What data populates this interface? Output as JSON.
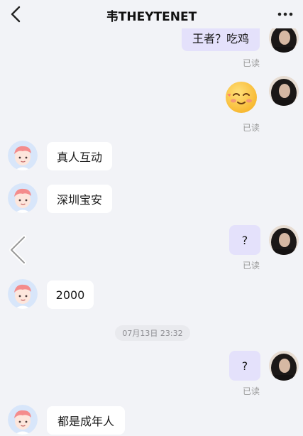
{
  "header": {
    "title": "韦THEYTENET",
    "back_icon": "chevron-left-icon",
    "more_icon": "more-dots-icon"
  },
  "messages": [
    {
      "side": "right",
      "text": "王者？吃鸡",
      "status": "已读"
    },
    {
      "side": "right",
      "emoji": "blushing-smile-emoji",
      "status": "已读"
    },
    {
      "side": "left",
      "text": "真人互动"
    },
    {
      "side": "left",
      "text": "深圳宝安"
    },
    {
      "side": "right",
      "text": "?",
      "status": "已读"
    },
    {
      "side": "left",
      "text": "2000"
    },
    {
      "side": "right",
      "text": "?",
      "status": "已读"
    },
    {
      "side": "left",
      "text": "都是成年人"
    }
  ],
  "timestamp": "07月13日 23:32",
  "colors": {
    "background": "#f2f3f7",
    "right_bubble": "#e4e1fb",
    "left_bubble": "#ffffff",
    "read_text": "#9a9a9a"
  }
}
